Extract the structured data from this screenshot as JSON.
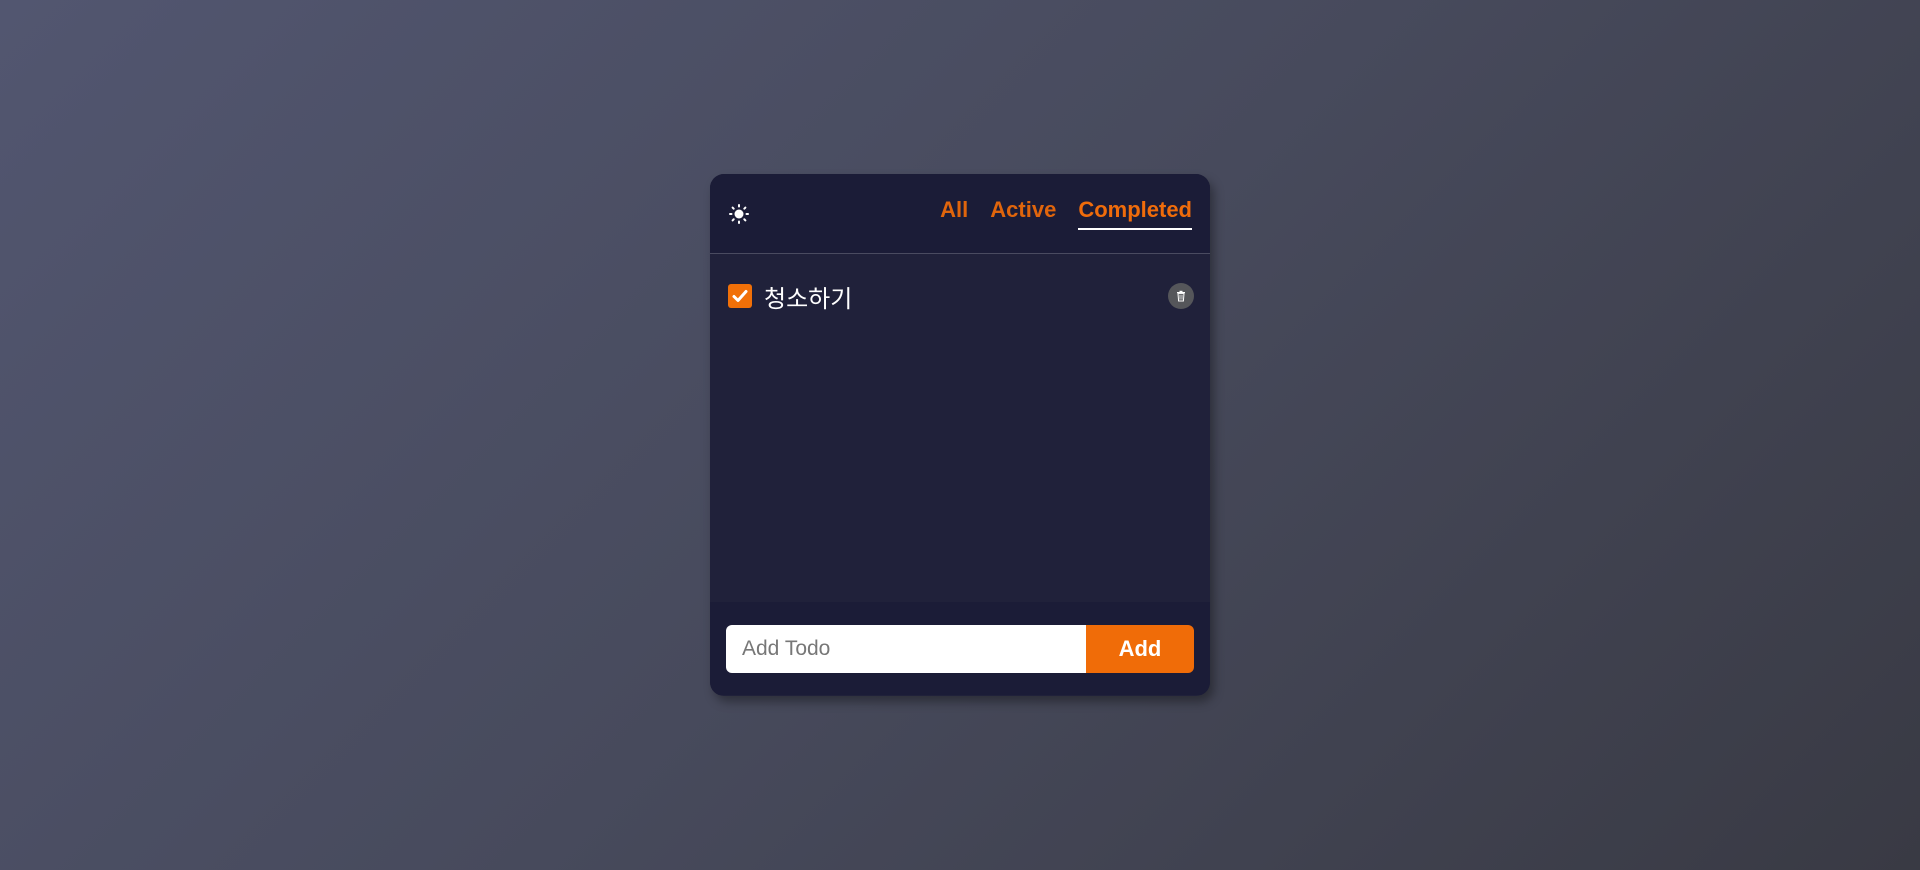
{
  "header": {
    "theme_icon": "sun-icon",
    "filters": [
      {
        "label": "All",
        "selected": false
      },
      {
        "label": "Active",
        "selected": false
      },
      {
        "label": "Completed",
        "selected": true
      }
    ]
  },
  "todos": [
    {
      "text": "청소하기",
      "completed": true,
      "delete_icon": "trash-icon"
    }
  ],
  "footer": {
    "input_placeholder": "Add Todo",
    "input_value": "",
    "add_label": "Add"
  },
  "colors": {
    "accent": "#f06c0b",
    "card_header": "#1b1c37",
    "card_body": "#20213a",
    "underline": "#ffffff"
  }
}
